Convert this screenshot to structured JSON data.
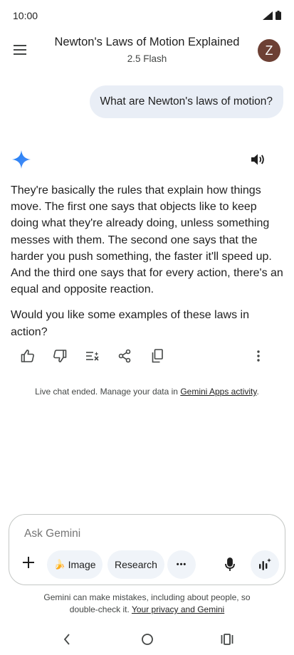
{
  "status_bar": {
    "time": "10:00"
  },
  "header": {
    "title": "Newton's Laws of Motion Explained",
    "subtitle": "2.5 Flash",
    "avatar_letter": "Z",
    "avatar_color": "#6d4034"
  },
  "conversation": {
    "user_message": "What are Newton's laws of motion?",
    "response_paragraphs": [
      "They're basically the rules that explain how things move. The first one says that objects like to keep doing what they're already doing, unless something messes with them. The second one says that the harder you push something, the faster it'll speed up. And the third one says that for every action, there's an equal and opposite reaction.",
      "Would you like some examples of these laws in action?"
    ]
  },
  "response_actions": [
    "thumbs-up-icon",
    "thumbs-down-icon",
    "modify-response-icon",
    "share-icon",
    "copy-icon",
    "more-vert-icon"
  ],
  "notice": {
    "prefix": "Live chat ended. Manage your data in ",
    "link": "Gemini Apps activity",
    "suffix": "."
  },
  "input": {
    "placeholder": "Ask Gemini",
    "chips": {
      "image": "Image",
      "image_emoji": "🍌",
      "research": "Research",
      "more": "•••"
    }
  },
  "disclaimer": {
    "line1": "Gemini can make mistakes, including about people, so",
    "line2_prefix": "double-check it. ",
    "link": "Your privacy and Gemini"
  },
  "colors": {
    "accent_blue": "#4285f4",
    "user_bubble": "#e9eef6",
    "chip_bg": "#f0f4f9"
  }
}
